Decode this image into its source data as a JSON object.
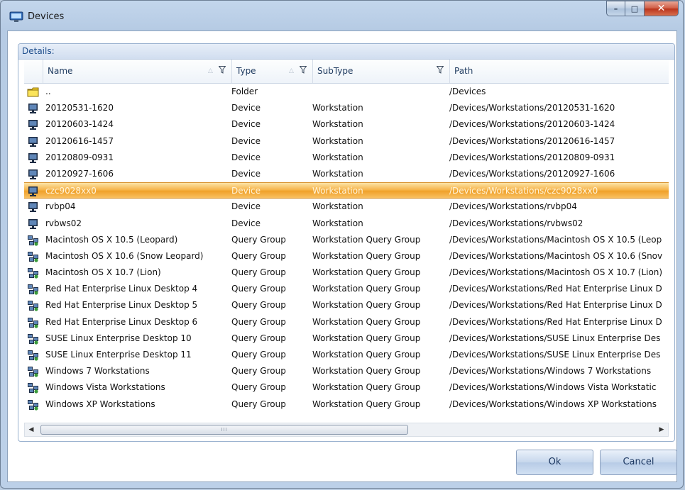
{
  "window": {
    "title": "Devices",
    "icon": "monitor-icon"
  },
  "panel": {
    "label": "Details:"
  },
  "columns": {
    "name": "Name",
    "type": "Type",
    "subtype": "SubType",
    "path": "Path"
  },
  "rows": [
    {
      "icon": "folder-icon",
      "name": "..",
      "type": "Folder",
      "subtype": "",
      "path": "/Devices"
    },
    {
      "icon": "computer-icon",
      "name": "20120531-1620",
      "type": "Device",
      "subtype": "Workstation",
      "path": "/Devices/Workstations/20120531-1620"
    },
    {
      "icon": "computer-icon",
      "name": "20120603-1424",
      "type": "Device",
      "subtype": "Workstation",
      "path": "/Devices/Workstations/20120603-1424"
    },
    {
      "icon": "computer-icon",
      "name": "20120616-1457",
      "type": "Device",
      "subtype": "Workstation",
      "path": "/Devices/Workstations/20120616-1457"
    },
    {
      "icon": "computer-icon",
      "name": "20120809-0931",
      "type": "Device",
      "subtype": "Workstation",
      "path": "/Devices/Workstations/20120809-0931"
    },
    {
      "icon": "computer-icon",
      "name": "20120927-1606",
      "type": "Device",
      "subtype": "Workstation",
      "path": "/Devices/Workstations/20120927-1606"
    },
    {
      "icon": "computer-icon",
      "name": "czc9028xx0",
      "type": "Device",
      "subtype": "Workstation",
      "path": "/Devices/Workstations/czc9028xx0",
      "selected": true
    },
    {
      "icon": "computer-icon",
      "name": "rvbp04",
      "type": "Device",
      "subtype": "Workstation",
      "path": "/Devices/Workstations/rvbp04"
    },
    {
      "icon": "computer-icon",
      "name": "rvbws02",
      "type": "Device",
      "subtype": "Workstation",
      "path": "/Devices/Workstations/rvbws02"
    },
    {
      "icon": "query-group-icon",
      "name": "Macintosh OS X 10.5 (Leopard)",
      "type": "Query Group",
      "subtype": "Workstation Query Group",
      "path": "/Devices/Workstations/Macintosh OS X 10.5 (Leop"
    },
    {
      "icon": "query-group-icon",
      "name": "Macintosh OS X 10.6 (Snow Leopard)",
      "type": "Query Group",
      "subtype": "Workstation Query Group",
      "path": "/Devices/Workstations/Macintosh OS X 10.6 (Snov"
    },
    {
      "icon": "query-group-icon",
      "name": "Macintosh OS X 10.7 (Lion)",
      "type": "Query Group",
      "subtype": "Workstation Query Group",
      "path": "/Devices/Workstations/Macintosh OS X 10.7 (Lion)"
    },
    {
      "icon": "query-group-icon",
      "name": "Red Hat Enterprise Linux Desktop 4",
      "type": "Query Group",
      "subtype": "Workstation Query Group",
      "path": "/Devices/Workstations/Red Hat Enterprise Linux D"
    },
    {
      "icon": "query-group-icon",
      "name": "Red Hat Enterprise Linux Desktop 5",
      "type": "Query Group",
      "subtype": "Workstation Query Group",
      "path": "/Devices/Workstations/Red Hat Enterprise Linux D"
    },
    {
      "icon": "query-group-icon",
      "name": "Red Hat Enterprise Linux Desktop 6",
      "type": "Query Group",
      "subtype": "Workstation Query Group",
      "path": "/Devices/Workstations/Red Hat Enterprise Linux D"
    },
    {
      "icon": "query-group-icon",
      "name": "SUSE Linux Enterprise Desktop 10",
      "type": "Query Group",
      "subtype": "Workstation Query Group",
      "path": "/Devices/Workstations/SUSE Linux Enterprise Des"
    },
    {
      "icon": "query-group-icon",
      "name": "SUSE Linux Enterprise Desktop 11",
      "type": "Query Group",
      "subtype": "Workstation Query Group",
      "path": "/Devices/Workstations/SUSE Linux Enterprise Des"
    },
    {
      "icon": "query-group-icon",
      "name": "Windows 7 Workstations",
      "type": "Query Group",
      "subtype": "Workstation Query Group",
      "path": "/Devices/Workstations/Windows 7 Workstations"
    },
    {
      "icon": "query-group-icon",
      "name": "Windows Vista Workstations",
      "type": "Query Group",
      "subtype": "Workstation Query Group",
      "path": "/Devices/Workstations/Windows Vista Workstatic"
    },
    {
      "icon": "query-group-icon",
      "name": "Windows XP Workstations",
      "type": "Query Group",
      "subtype": "Workstation Query Group",
      "path": "/Devices/Workstations/Windows XP Workstations"
    }
  ],
  "scrollbar": {
    "thumb_grip": "III"
  },
  "buttons": {
    "ok": "Ok",
    "cancel": "Cancel"
  },
  "colors": {
    "selection": "#f6b64e",
    "header_text": "#1e4e8c"
  }
}
